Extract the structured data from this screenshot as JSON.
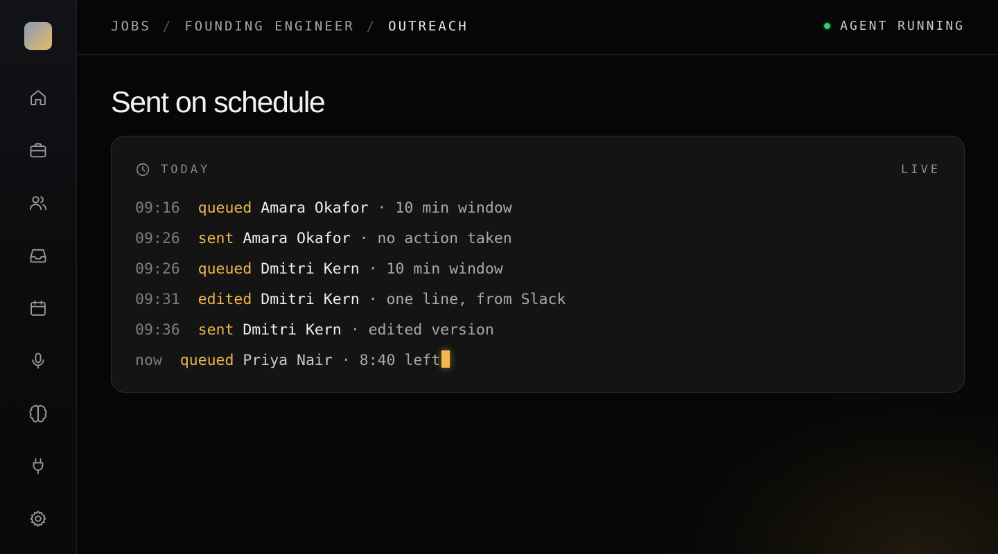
{
  "sidebar": {
    "icons": [
      "home-icon",
      "briefcase-icon",
      "users-icon",
      "inbox-icon",
      "calendar-icon",
      "microphone-icon",
      "brain-icon",
      "plug-icon",
      "gear-icon"
    ]
  },
  "header": {
    "breadcrumb": [
      "JOBS",
      "FOUNDING ENGINEER",
      "OUTREACH"
    ],
    "separator": "/",
    "status": "AGENT RUNNING",
    "status_color": "#2fcf6b"
  },
  "page": {
    "title": "Sent on schedule"
  },
  "card": {
    "label": "TODAY",
    "badge": "LIVE",
    "rows": [
      {
        "time": "09:16",
        "event": "queued",
        "name": "Amara Okafor",
        "detail": "· 10 min window"
      },
      {
        "time": "09:26",
        "event": "sent",
        "name": "Amara Okafor",
        "detail": "· no action taken"
      },
      {
        "time": "09:26",
        "event": "queued",
        "name": "Dmitri Kern",
        "detail": "· 10 min window"
      },
      {
        "time": "09:31",
        "event": "edited",
        "name": "Dmitri Kern",
        "detail": "· one line, from Slack"
      },
      {
        "time": "09:36",
        "event": "sent",
        "name": "Dmitri Kern",
        "detail": "· edited version"
      },
      {
        "time": "now",
        "event": "queued",
        "name": "Priya Nair",
        "detail": "· 8:40 left"
      }
    ]
  },
  "colors": {
    "accent": "#f0b84e",
    "background": "#060606",
    "card": "#141414"
  }
}
